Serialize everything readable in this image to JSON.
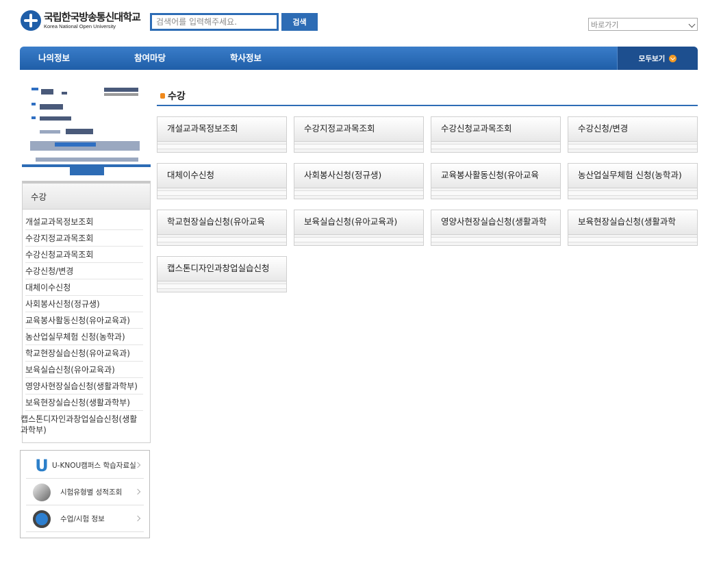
{
  "header": {
    "logo_ko": "국립한국방송통신대학교",
    "logo_en": "Korea National Open University",
    "search_placeholder": "검색어를 입력해주세요.",
    "search_button": "검색",
    "goto_select": "바로가기"
  },
  "gnb": {
    "items": [
      "나의정보",
      "참여마당",
      "학사정보"
    ],
    "all_label": "모두보기",
    "accent": "#2d6cb5",
    "all_icon_color": "#f39a24"
  },
  "side": {
    "title": "수강",
    "items": [
      "개설교과목정보조회",
      "수강지정교과목조회",
      "수강신청교과목조회",
      "수강신청/변경",
      "대체이수신청",
      "사회봉사신청(정규생)",
      "교육봉사활동신청(유아교육과)",
      "농산업실무체험 신청(농학과)",
      "학교현장실습신청(유아교육과)",
      "보육실습신청(유아교육과)",
      "영양사현장실습신청(생활과학부)",
      "보육현장실습신청(생활과학부)",
      "캡스톤디자인과창업실습신청(생활과학부)"
    ]
  },
  "quick": {
    "items": [
      "U-KNOU캠퍼스 학습자료실",
      "시험유형별 성적조회",
      "수업/시험 정보"
    ],
    "icons": [
      "u-knou-logo-icon",
      "mouse-icon",
      "headphone-icon"
    ]
  },
  "main": {
    "section_title": "수강",
    "cards": [
      "개설교과목정보조회",
      "수강지정교과목조회",
      "수강신청교과목조회",
      "수강신청/변경",
      "대체이수신청",
      "사회봉사신청(정규생)",
      "교육봉사활동신청(유아교육",
      "농산업실무체험 신청(농학과)",
      "학교현장실습신청(유아교육",
      "보육실습신청(유아교육과)",
      "영양사현장실습신청(생활과학",
      "보육현장실습신청(생활과학",
      "캡스톤디자인과창업실습신청"
    ],
    "bullet_color": "#f08a1c"
  }
}
